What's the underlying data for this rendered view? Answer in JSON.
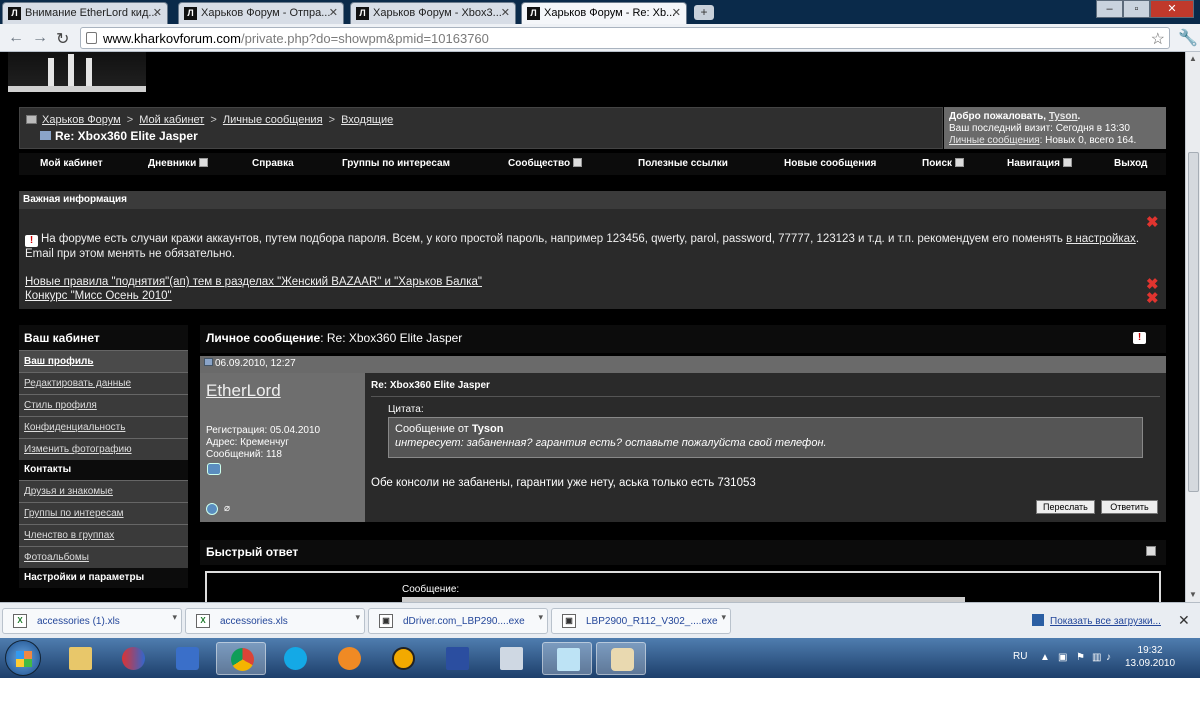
{
  "browser": {
    "tabs": [
      {
        "title": "Внимание EtherLord кид..."
      },
      {
        "title": "Харьков Форум - Отпра..."
      },
      {
        "title": "Харьков Форум - Xbox3..."
      },
      {
        "title": "Харьков Форум - Re: Xb..."
      }
    ],
    "url_host": "www.kharkovforum.com",
    "url_path": "/private.php?do=showpm&pmid=10163760"
  },
  "breadcrumb": {
    "items": [
      "Харьков Форум",
      "Мой кабинет",
      "Личные сообщения",
      "Входящие"
    ],
    "separator": ">",
    "title": "Re: Xbox360 Elite Jasper"
  },
  "welcome": {
    "greeting": "Добро пожаловать,",
    "username": "Tyson",
    "dot": ".",
    "last_visit": "Ваш последний визит: Сегодня в 13:30",
    "pm_link": "Личные сообщения",
    "pm_stats": ": Новых 0, всего 164."
  },
  "navbar": {
    "items": [
      "Мой кабинет",
      "Дневники",
      "Справка",
      "Группы по интересам",
      "Сообщество",
      "Полезные ссылки",
      "Новые сообщения",
      "Поиск",
      "Навигация",
      "Выход"
    ]
  },
  "important": {
    "heading": "Важная информация",
    "notice_pre": "На форуме есть случаи кражи аккаунтов, путем подбора пароля. Всем, у кого простой пароль, например 123456, qwerty, parol, password, 77777, 123123 и т.д. и т.п. рекомендуем его поменять ",
    "notice_link": "в настройках",
    "notice_post": ". Email при этом менять не обязательно.",
    "rules": [
      "Новые правила \"поднятия\"(ап) тем в разделах \"Женский BAZAAR\" и \"Харьков Балка\"",
      "Конкурс \"Мисс Осень 2010\""
    ]
  },
  "sidebar": {
    "title": "Ваш кабинет",
    "profile_items": [
      "Ваш профиль",
      "Редактировать данные",
      "Стиль профиля",
      "Конфиденциальность",
      "Изменить фотографию"
    ],
    "contacts_title": "Контакты",
    "contacts_items": [
      "Друзья и знакомые",
      "Группы по интересам",
      "Членство в группах",
      "Фотоальбомы"
    ],
    "settings_title": "Настройки и параметры"
  },
  "pm": {
    "heading_label": "Личное сообщение",
    "heading_subject": ": Re: Xbox360 Elite Jasper",
    "date": "06.09.2010, 12:27",
    "author": "EtherLord",
    "registration": "Регистрация: 05.04.2010",
    "address": "Адрес: Кременчуг",
    "messages": "Сообщений: 118",
    "title": "Re: Xbox360 Elite Jasper",
    "quote_label": "Цитата:",
    "quote_from": "Сообщение от",
    "quote_author": "Tyson",
    "quote_text": "интересует: забаненная? гарантия есть? оставьте пожалуйста свой телефон.",
    "body": "Обе консоли не забанены, гарантии уже нету, аська только есть 731053",
    "forward_button": "Переслать",
    "reply_button": "Ответить"
  },
  "quick_reply": {
    "title": "Быстрый ответ",
    "message_label": "Сообщение:"
  },
  "downloads": {
    "items": [
      "accessories (1).xls",
      "accessories.xls",
      "dDriver.com_LBP290....exe",
      "LBP2900_R112_V302_....exe"
    ],
    "show_all": "Показать все загрузки..."
  },
  "taskbar": {
    "lang": "RU",
    "time": "19:32",
    "date": "13.09.2010"
  },
  "colors": {
    "page_bg": "#000000",
    "panel": "#2a2a2a",
    "accent_red": "#e0342f",
    "link": "#e8e8e8"
  }
}
